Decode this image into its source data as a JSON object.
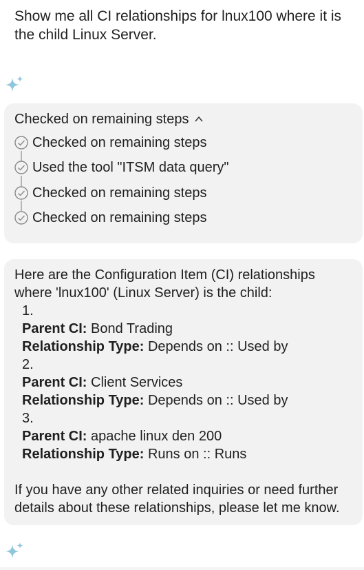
{
  "user_message": "Show me all CI relationships for lnux100 where it is the child Linux Server.",
  "steps": {
    "header": "Checked on remaining steps",
    "items": [
      "Checked on remaining steps",
      "Used the tool \"ITSM data query\"",
      "Checked on remaining steps",
      "Checked on remaining steps"
    ]
  },
  "answer": {
    "intro_line1": "Here are the Configuration Item (CI) relationships",
    "intro_line2": "where 'lnux100' (Linux Server) is the child:",
    "parent_label": "Parent CI:",
    "relationship_label": "Relationship Type:",
    "entries": [
      {
        "number": "1.",
        "parent": "Bond Trading",
        "relationship": "Depends on :: Used by"
      },
      {
        "number": "2.",
        "parent": "Client Services",
        "relationship": "Depends on :: Used by"
      },
      {
        "number": "3.",
        "parent": "apache linux den 200",
        "relationship": "Runs on :: Runs"
      }
    ],
    "closing_line1": "If you have any other related inquiries or need further",
    "closing_line2": "details about these relationships, please let me know."
  },
  "colors": {
    "sparkle": "#8ec6dc",
    "card_background": "#f2f2f2",
    "step_icon": "#8a8a8a"
  }
}
